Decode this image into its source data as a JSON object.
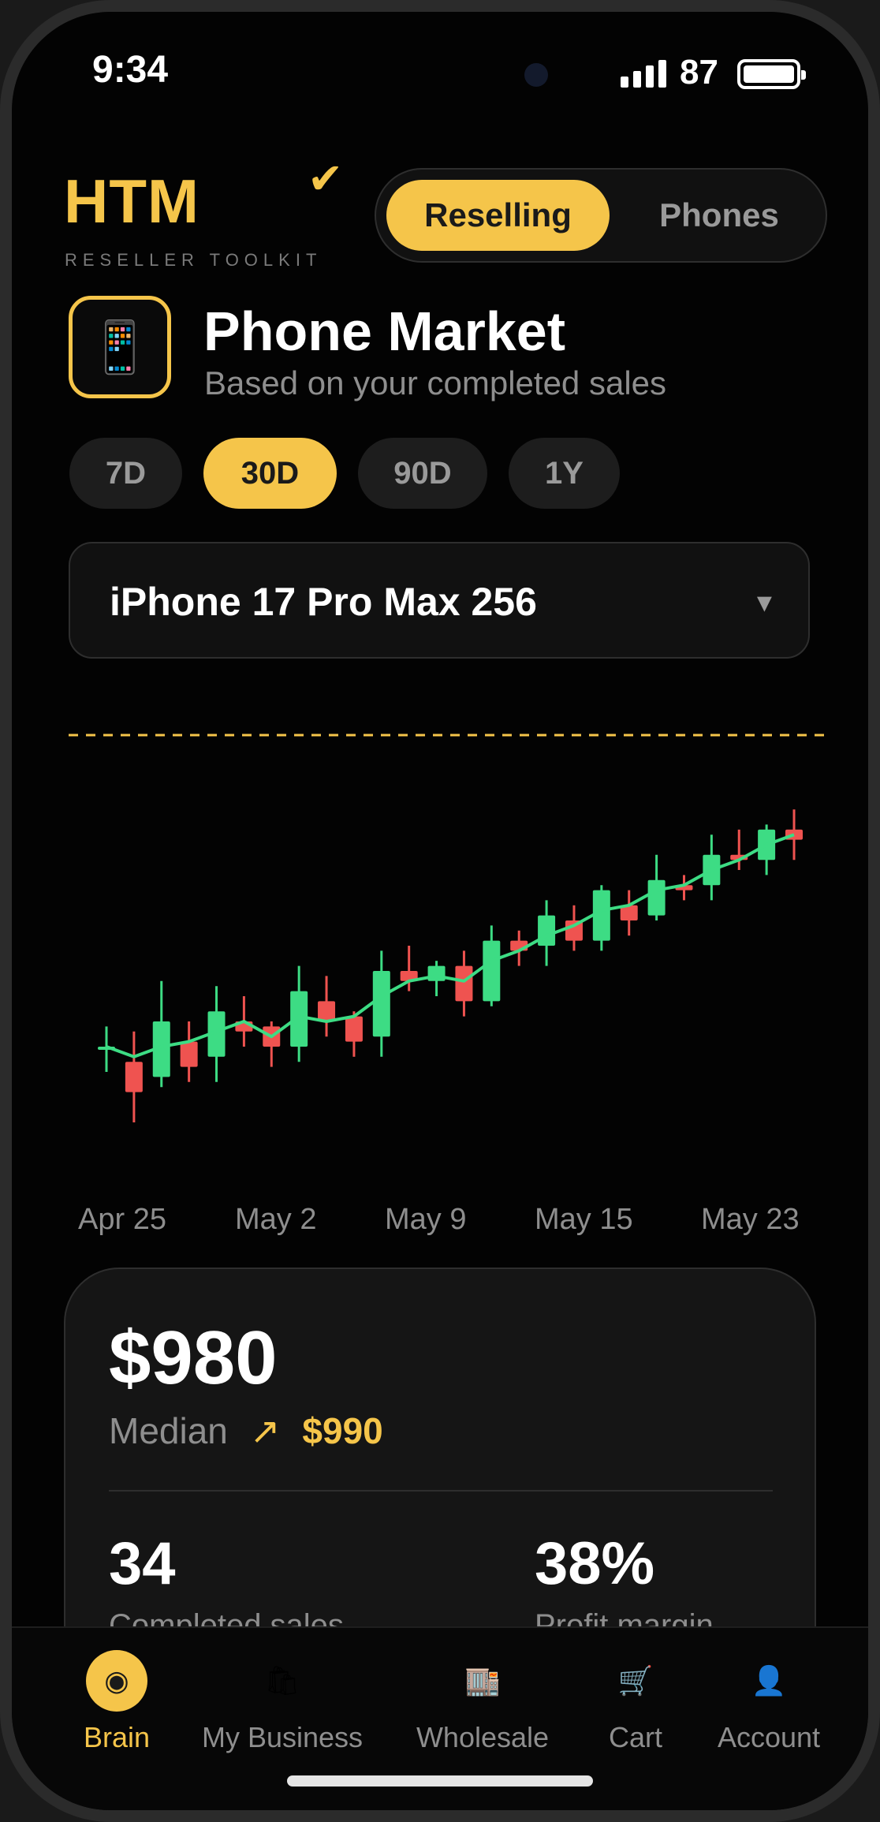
{
  "status": {
    "time": "9:34",
    "battery": "87"
  },
  "header": {
    "logo": "HTM",
    "logo_mark": "✔",
    "tagline": "RESELLER TOOLKIT",
    "segments": [
      "Reselling",
      "Phones"
    ]
  },
  "title": {
    "icon": "📱",
    "heading": "Phone Market",
    "subtitle": "Based on your completed sales"
  },
  "ranges": [
    "7D",
    "30D",
    "90D",
    "1Y"
  ],
  "selected_range": "30D",
  "device_select": {
    "value": "iPhone 17 Pro Max 256",
    "caret": "▾"
  },
  "chart_data": {
    "type": "candlestick",
    "x_labels": [
      "Apr 25",
      "May 2",
      "May 9",
      "May 15",
      "May 23"
    ],
    "reference_line": "dashed",
    "candles": [
      {
        "o": 955,
        "c": 955,
        "h": 959,
        "l": 950
      },
      {
        "o": 952,
        "c": 946,
        "h": 958,
        "l": 940
      },
      {
        "o": 949,
        "c": 960,
        "h": 968,
        "l": 947
      },
      {
        "o": 956,
        "c": 951,
        "h": 960,
        "l": 948
      },
      {
        "o": 953,
        "c": 962,
        "h": 967,
        "l": 948
      },
      {
        "o": 960,
        "c": 958,
        "h": 965,
        "l": 955
      },
      {
        "o": 959,
        "c": 955,
        "h": 960,
        "l": 951
      },
      {
        "o": 955,
        "c": 966,
        "h": 971,
        "l": 952
      },
      {
        "o": 964,
        "c": 960,
        "h": 969,
        "l": 957
      },
      {
        "o": 961,
        "c": 956,
        "h": 962,
        "l": 953
      },
      {
        "o": 957,
        "c": 970,
        "h": 974,
        "l": 953
      },
      {
        "o": 970,
        "c": 968,
        "h": 975,
        "l": 966
      },
      {
        "o": 968,
        "c": 971,
        "h": 972,
        "l": 965
      },
      {
        "o": 971,
        "c": 964,
        "h": 974,
        "l": 961
      },
      {
        "o": 964,
        "c": 976,
        "h": 979,
        "l": 963
      },
      {
        "o": 976,
        "c": 974,
        "h": 978,
        "l": 971
      },
      {
        "o": 975,
        "c": 981,
        "h": 984,
        "l": 971
      },
      {
        "o": 980,
        "c": 976,
        "h": 983,
        "l": 974
      },
      {
        "o": 976,
        "c": 986,
        "h": 987,
        "l": 974
      },
      {
        "o": 983,
        "c": 980,
        "h": 986,
        "l": 977
      },
      {
        "o": 981,
        "c": 988,
        "h": 993,
        "l": 980
      },
      {
        "o": 987,
        "c": 986,
        "h": 989,
        "l": 984
      },
      {
        "o": 987,
        "c": 993,
        "h": 997,
        "l": 984
      },
      {
        "o": 993,
        "c": 992,
        "h": 998,
        "l": 990
      },
      {
        "o": 992,
        "c": 998,
        "h": 999,
        "l": 989
      },
      {
        "o": 998,
        "c": 996,
        "h": 1002,
        "l": 992
      }
    ],
    "trend": [
      955,
      953,
      955,
      956,
      958,
      960,
      957,
      961,
      960,
      961,
      965,
      968,
      969,
      968,
      972,
      974,
      977,
      979,
      982,
      983,
      986,
      987,
      990,
      992,
      995,
      997
    ],
    "y_range": [
      935,
      1010
    ],
    "colors": {
      "up": "#3ddc84",
      "down": "#ef5350",
      "trend": "#3ddc84",
      "reference": "#f5c54a"
    }
  },
  "stats": {
    "price": "$980",
    "median_label": "Median",
    "median_arrow": "↗",
    "median_value": "$990",
    "completed_sales": "34",
    "completed_label": "Completed sales",
    "profit_margin": "38%",
    "profit_label": "Profit margin"
  },
  "tabs": [
    {
      "icon": "◉",
      "label": "Brain"
    },
    {
      "icon": "🛍",
      "label": "My Business"
    },
    {
      "icon": "🏬",
      "label": "Wholesale"
    },
    {
      "icon": "🛒",
      "label": "Cart"
    },
    {
      "icon": "👤",
      "label": "Account"
    }
  ],
  "colors": {
    "accent": "#f5c54a",
    "background": "#030303",
    "card": "#151515"
  }
}
